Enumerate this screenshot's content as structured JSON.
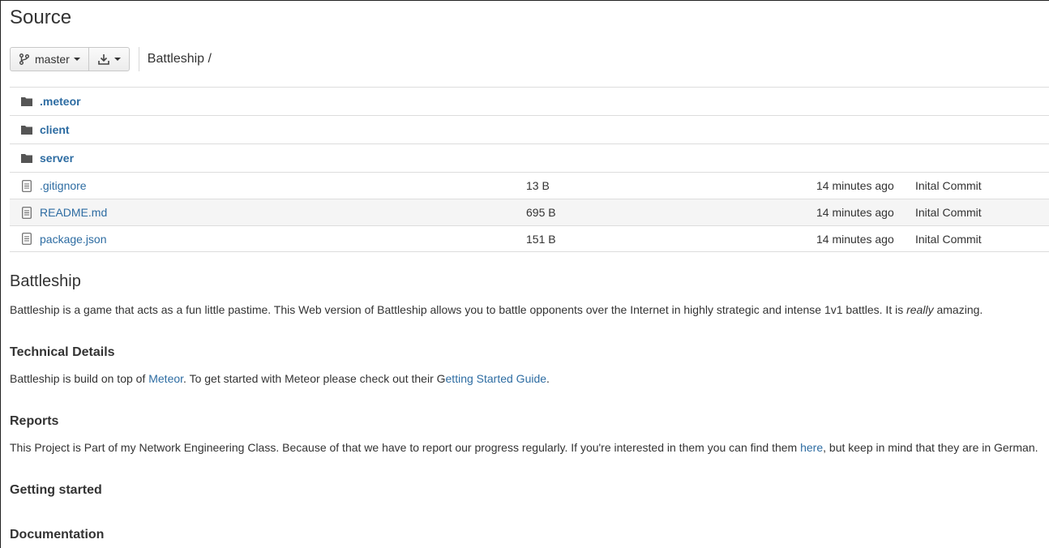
{
  "page": {
    "title": "Source"
  },
  "toolbar": {
    "branch_label": "master",
    "download_icon": "download-icon",
    "breadcrumb": "Battleship /"
  },
  "files": [
    {
      "type": "dir",
      "icon": "folder-icon",
      "name": ".meteor"
    },
    {
      "type": "dir",
      "icon": "folder-icon",
      "name": "client"
    },
    {
      "type": "dir",
      "icon": "folder-icon",
      "name": "server"
    },
    {
      "type": "file",
      "icon": "file-icon",
      "name": ".gitignore",
      "size": "13 B",
      "time": "14 minutes ago",
      "message": "Inital Commit"
    },
    {
      "type": "file",
      "icon": "file-icon",
      "name": "README.md",
      "size": "695 B",
      "time": "14 minutes ago",
      "message": "Inital Commit"
    },
    {
      "type": "file",
      "icon": "file-icon",
      "name": "package.json",
      "size": "151 B",
      "time": "14 minutes ago",
      "message": "Inital Commit"
    }
  ],
  "readme": {
    "title": "Battleship",
    "intro_a": "Battleship is a game that acts as a fun little pastime. This Web version of Battleship allows you to battle opponents over the Internet in highly strategic and intense 1v1 battles. It is ",
    "intro_em": "really",
    "intro_b": " amazing.",
    "tech_heading": "Technical Details",
    "tech_a": "Battleship is build on top of ",
    "tech_link1": "Meteor",
    "tech_b": ". To get started with Meteor please check out their G",
    "tech_link2": "etting Started Guide",
    "tech_c": ".",
    "reports_heading": "Reports",
    "reports_a": "This Project is Part of my Network Engineering Class. Because of that we have to report our progress regularly. If you're interested in them you can find them ",
    "reports_link": "here",
    "reports_b": ", but keep in mind that they are in German.",
    "getting_started_heading": "Getting started",
    "documentation_heading": "Documentation"
  },
  "colors": {
    "link": "#2d6ca2",
    "text": "#333333",
    "border": "#dddddd",
    "row_highlight": "#f5f5f5"
  }
}
